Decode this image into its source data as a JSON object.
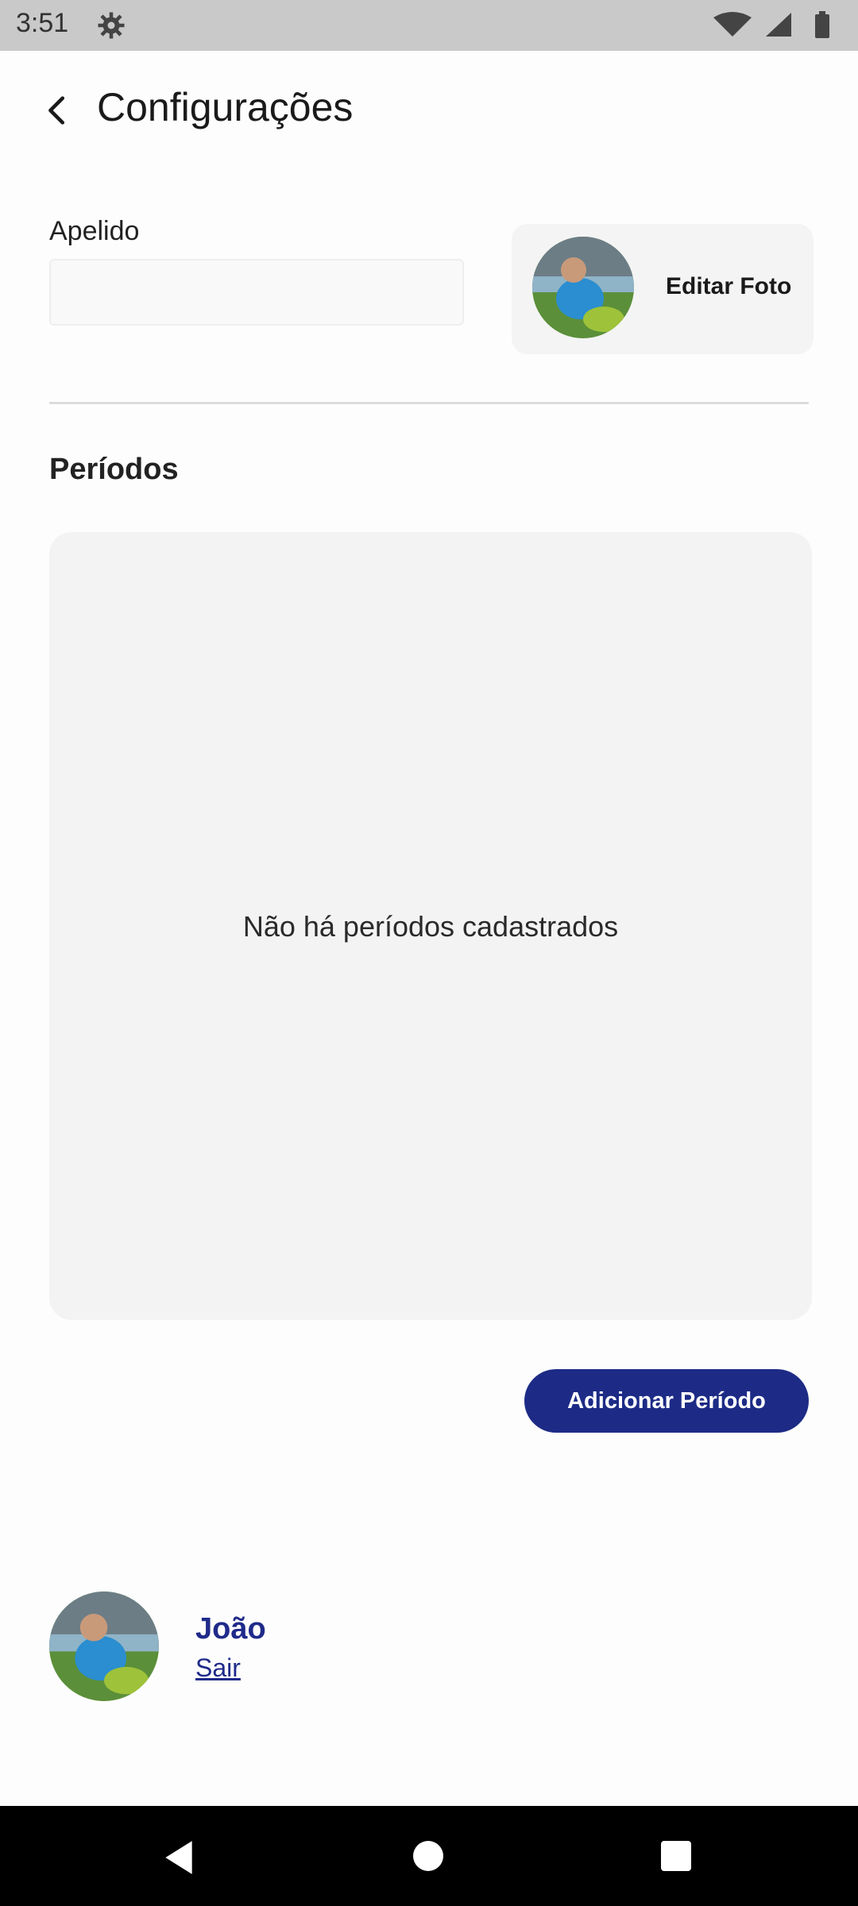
{
  "status_bar": {
    "time": "3:51",
    "icons": [
      "settings-gear-icon",
      "wifi-icon",
      "signal-icon",
      "battery-icon"
    ]
  },
  "header": {
    "title": "Configurações",
    "back_icon": "chevron-left-icon"
  },
  "profile": {
    "nickname_label": "Apelido",
    "nickname_value": "",
    "edit_photo_label": "Editar Foto"
  },
  "periods": {
    "title": "Períodos",
    "empty_message": "Não há períodos cadastrados",
    "add_button_label": "Adicionar Período"
  },
  "user": {
    "name": "João",
    "logout_label": "Sair"
  },
  "nav": {
    "back_icon": "nav-back-icon",
    "home_icon": "nav-home-icon",
    "recent_icon": "nav-recent-icon"
  },
  "colors": {
    "accent": "#1d2b86",
    "link": "#1f2a8a",
    "card_bg": "#f3f3f3"
  }
}
